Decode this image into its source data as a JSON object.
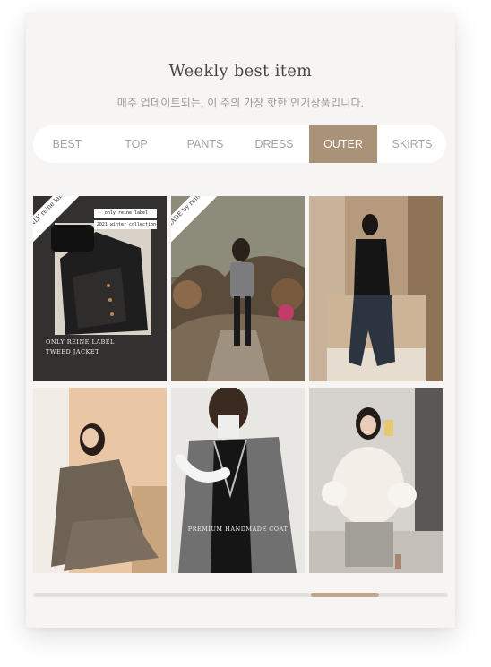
{
  "section": {
    "title": "Weekly best item",
    "subtitle": "매주 업데이트되는, 이 주의 가장 핫한 인기상품입니다."
  },
  "tabs": [
    {
      "label": "BEST",
      "active": false
    },
    {
      "label": "TOP",
      "active": false
    },
    {
      "label": "PANTS",
      "active": false
    },
    {
      "label": "DRESS",
      "active": false
    },
    {
      "label": "OUTER",
      "active": true
    },
    {
      "label": "SKIRTS",
      "active": false
    }
  ],
  "products": [
    {
      "image": "tweed-jacket-flatlay",
      "ribbon": "ONLY reine label",
      "tag_line1": "only reine label",
      "tag_line2": "2021 winter collection",
      "caption_line1": "ONLY REINE LABEL",
      "caption_line2": "TWEED JACKET"
    },
    {
      "image": "model-cropped-tweed-jacket-garden",
      "ribbon": "MADE by reine"
    },
    {
      "image": "model-black-knit-jeans-mirror"
    },
    {
      "image": "model-gray-blazer-seated"
    },
    {
      "image": "gray-handmade-coat",
      "caption_line1": "PREMIUM HANDMADE COAT"
    },
    {
      "image": "model-white-fur-jacket-mirror"
    }
  ],
  "colors": {
    "accent": "#a99277",
    "card_bg": "#f6f5f4",
    "scroll_thumb": "#c0a78b"
  },
  "scrollbar": {
    "position_percent": 75
  }
}
